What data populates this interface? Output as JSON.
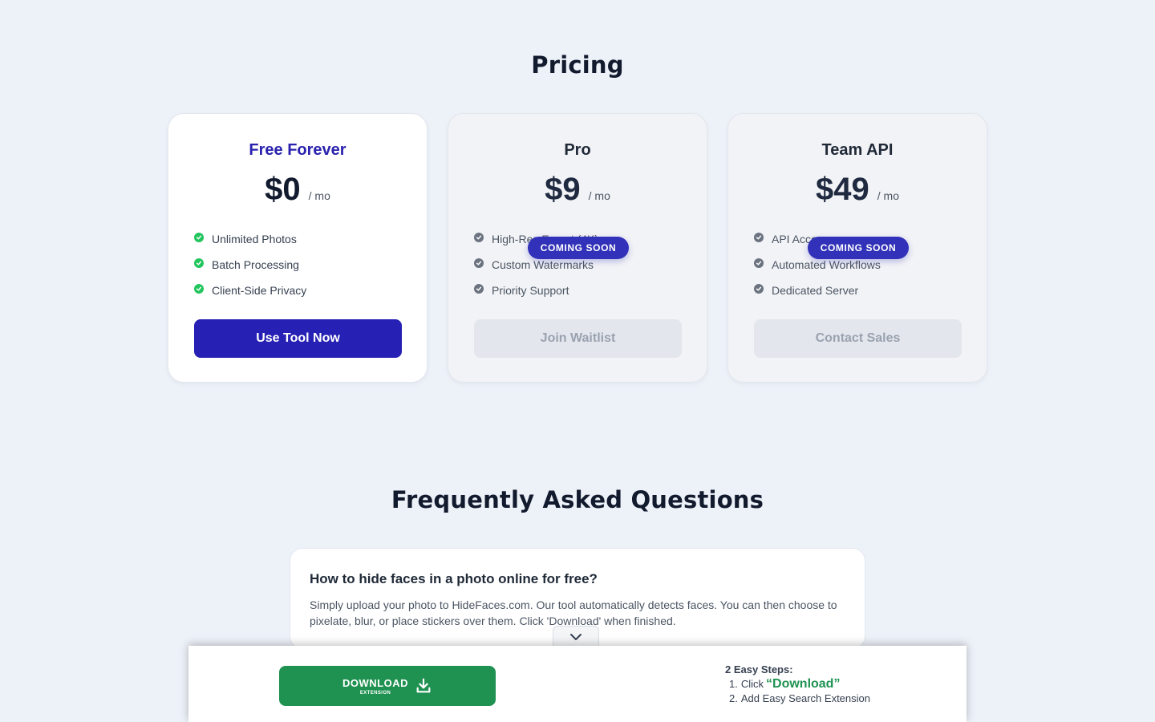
{
  "pricing": {
    "title": "Pricing",
    "plans": [
      {
        "name": "Free Forever",
        "price": "$0",
        "period": "/ mo",
        "features": [
          "Unlimited Photos",
          "Batch Processing",
          "Client-Side Privacy"
        ],
        "cta": "Use Tool Now"
      },
      {
        "name": "Pro",
        "price": "$9",
        "period": "/ mo",
        "features": [
          "High-Res Export (4K)",
          "Custom Watermarks",
          "Priority Support"
        ],
        "badge": "COMING SOON",
        "cta": "Join Waitlist"
      },
      {
        "name": "Team API",
        "price": "$49",
        "period": "/ mo",
        "features": [
          "API Access",
          "Automated Workflows",
          "Dedicated Server"
        ],
        "badge": "COMING SOON",
        "cta": "Contact Sales"
      }
    ]
  },
  "faq": {
    "title": "Frequently Asked Questions",
    "items": [
      {
        "question": "How to hide faces in a photo online for free?",
        "answer": "Simply upload your photo to HideFaces.com. Our tool automatically detects faces. You can then choose to pixelate, blur, or place stickers over them. Click 'Download' when finished."
      }
    ]
  },
  "bottom_bar": {
    "download_label": "DOWNLOAD",
    "download_sub": "EXTENSION",
    "steps_title": "2 Easy Steps:",
    "step1_num": "1.",
    "step1_prefix": "Click",
    "step1_highlight": "“Download”",
    "step2_num": "2.",
    "step2_text": "Add Easy Search Extension"
  },
  "colors": {
    "primary": "#2620b4",
    "badge": "#3131b9",
    "success": "#22c55e",
    "download": "#1f9251",
    "background": "#edf1f8"
  },
  "icons": {
    "feature_included": "check-circle-icon",
    "collapse_toggle": "chevron-down-icon",
    "download": "download-icon"
  }
}
